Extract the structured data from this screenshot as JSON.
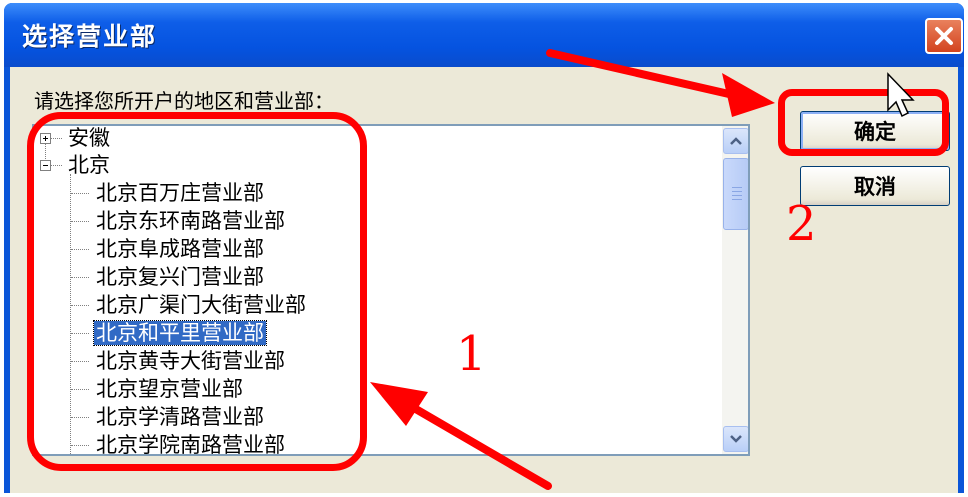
{
  "dialog": {
    "title": "选择营业部",
    "prompt": "请选择您所开户的地区和营业部："
  },
  "tree": {
    "nodes": [
      {
        "label": "安徽",
        "expanded": false
      },
      {
        "label": "北京",
        "expanded": true
      }
    ],
    "children": [
      "北京百万庄营业部",
      "北京东环南路营业部",
      "北京阜成路营业部",
      "北京复兴门营业部",
      "北京广渠门大街营业部",
      "北京和平里营业部",
      "北京黄寺大街营业部",
      "北京望京营业部",
      "北京学清路营业部",
      "北京学院南路营业部"
    ],
    "selected": "北京和平里营业部"
  },
  "buttons": {
    "ok": "确定",
    "cancel": "取消"
  },
  "annotations": {
    "marker_1": "1",
    "marker_2": "2",
    "color": "#ff0000"
  },
  "colors": {
    "titlebar": "#0553e0",
    "dialog_bg": "#ece9d8",
    "selection": "#316ac5",
    "close_button": "#d3431f"
  }
}
